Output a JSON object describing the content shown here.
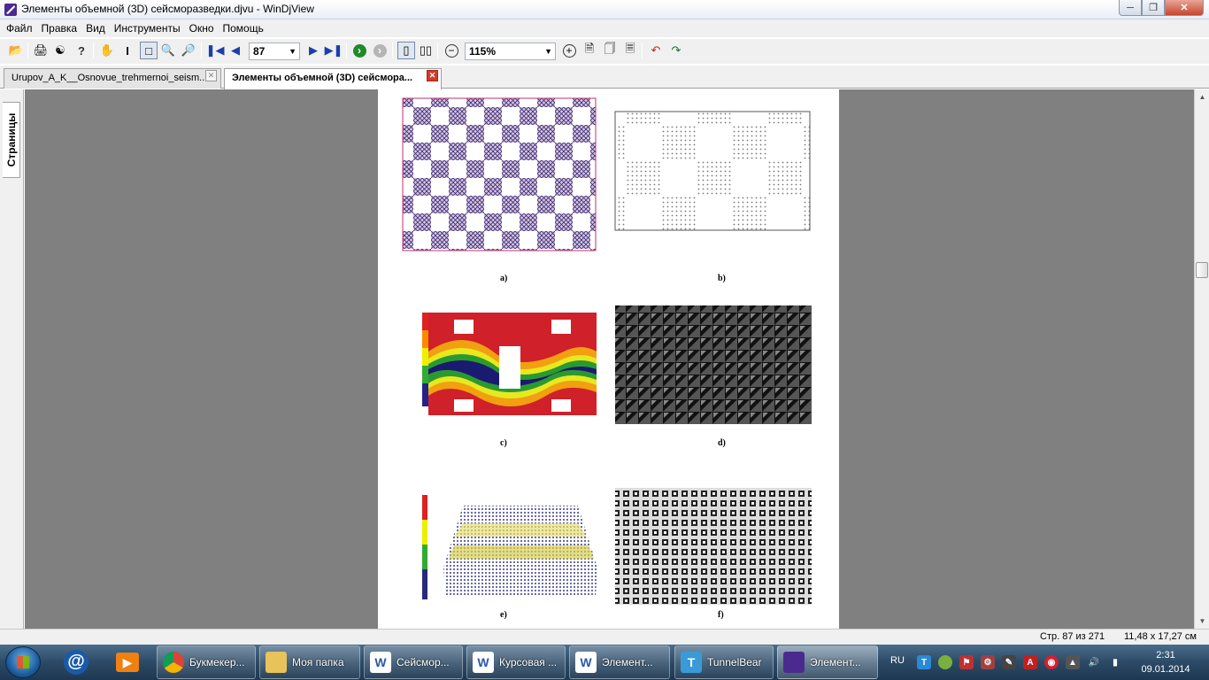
{
  "window": {
    "title": "Элементы объемной (3D) сейсморазведки.djvu - WinDjView",
    "minimize_icon": "minimize-icon",
    "maximize_icon": "restore-icon",
    "close_icon": "close-icon"
  },
  "menu": [
    "Файл",
    "Правка",
    "Вид",
    "Инструменты",
    "Окно",
    "Помощь"
  ],
  "toolbar": {
    "page_number": "87",
    "zoom": "115%"
  },
  "tabs": [
    {
      "label": "Urupov_A_K__Osnovue_trehmernoi_seism..."
    },
    {
      "label": "Элементы объемной (3D) сейсмора..."
    }
  ],
  "sidebar": {
    "pages_tab": "Страницы"
  },
  "figure_labels": [
    "a)",
    "b)",
    "c)",
    "d)",
    "e)",
    "f)"
  ],
  "status": {
    "page": "Стр. 87 из 271",
    "size": "11,48 x 17,27 см"
  },
  "taskbar": {
    "tasks": [
      {
        "label": "Букмекер..."
      },
      {
        "label": "Моя папка"
      },
      {
        "label": "Сейсмор..."
      },
      {
        "label": "Курсовая ..."
      },
      {
        "label": "Элемент..."
      },
      {
        "label": "TunnelBear"
      },
      {
        "label": "Элемент..."
      }
    ],
    "language": "RU",
    "time": "2:31",
    "date": "09.01.2014"
  },
  "colors": {
    "viewer_bg": "#808080",
    "taskbar": "#2c4a66",
    "accent_close": "#c7462d"
  }
}
